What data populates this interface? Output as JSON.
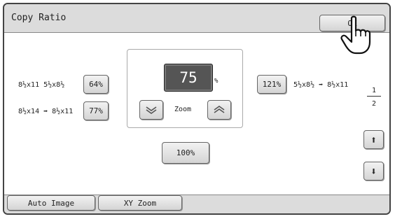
{
  "window": {
    "title": "Copy Ratio",
    "ok_label": "OK"
  },
  "preset_left": [
    {
      "size_label": "8½x11  5½x8½",
      "button": "64%"
    },
    {
      "size_label": "8½x14 ➡ 8½x11",
      "button": "77%"
    }
  ],
  "preset_right": {
    "button": "121%",
    "size_label": "5½x8½ ➡ 8½x11"
  },
  "zoom": {
    "value": "75",
    "unit": "%",
    "label": "Zoom",
    "reset_button": "100%"
  },
  "pager": {
    "current": "1",
    "total": "2"
  },
  "footer": {
    "auto_image": "Auto Image",
    "xy_zoom": "XY Zoom"
  }
}
